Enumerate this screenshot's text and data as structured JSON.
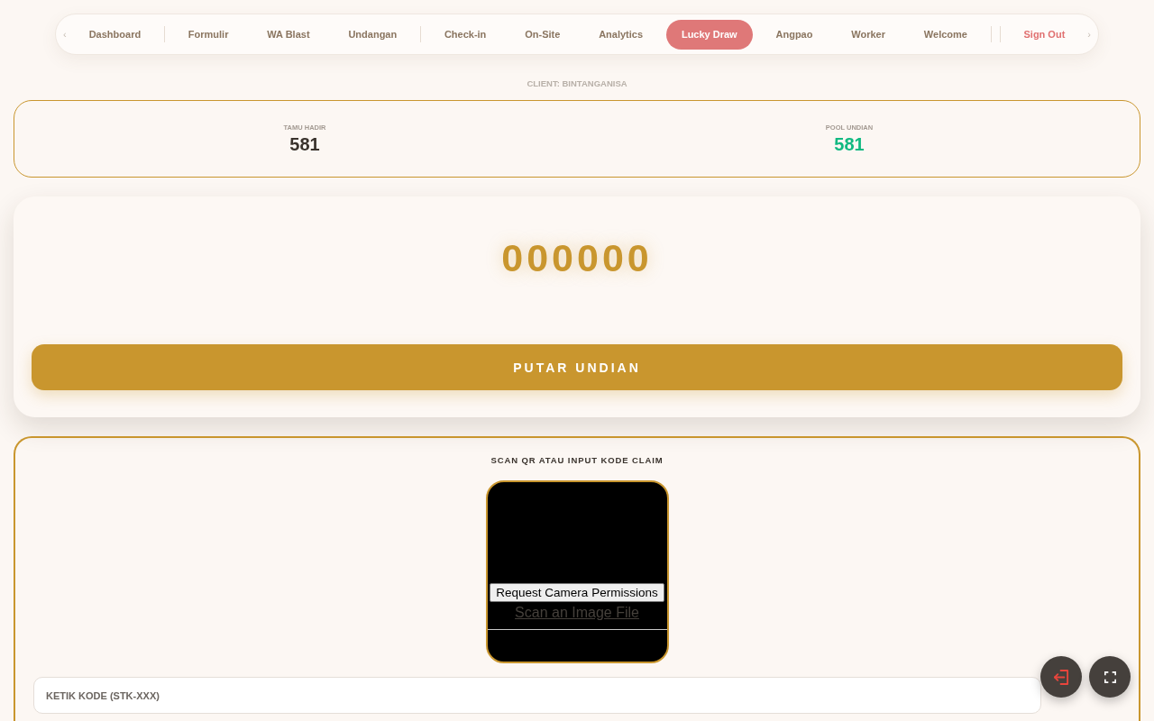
{
  "nav": {
    "scroll_left": "‹",
    "scroll_right": "›",
    "items": [
      {
        "kind": "link",
        "label": "Dashboard",
        "selected": false
      },
      {
        "kind": "divider"
      },
      {
        "kind": "link",
        "label": "Formulir",
        "selected": false
      },
      {
        "kind": "link",
        "label": "WA Blast",
        "selected": false
      },
      {
        "kind": "link",
        "label": "Undangan",
        "selected": false
      },
      {
        "kind": "divider"
      },
      {
        "kind": "link",
        "label": "Check-in",
        "selected": false
      },
      {
        "kind": "link",
        "label": "On-Site",
        "selected": false
      },
      {
        "kind": "link",
        "label": "Analytics",
        "selected": false
      },
      {
        "kind": "link",
        "label": "Lucky Draw",
        "selected": true
      },
      {
        "kind": "link",
        "label": "Angpao",
        "selected": false
      },
      {
        "kind": "link",
        "label": "Worker",
        "selected": false
      },
      {
        "kind": "link",
        "label": "Welcome",
        "selected": false
      },
      {
        "kind": "divider"
      },
      {
        "kind": "divider"
      },
      {
        "kind": "danger",
        "label": "Sign Out",
        "selected": false
      }
    ]
  },
  "client_label": "CLIENT: BINTANGANISA",
  "stats": [
    {
      "label": "TAMU HADIR",
      "value": "581",
      "color": "#3a332d"
    },
    {
      "label": "POOL UNDIAN",
      "value": "581",
      "color": "#10b981"
    }
  ],
  "draw": {
    "number": "000000",
    "button": "PUTAR UNDIAN"
  },
  "claim": {
    "title": "SCAN QR ATAU INPUT KODE CLAIM",
    "scanner": {
      "permission_button": "Request Camera Permissions",
      "file_link": "Scan an Image File"
    },
    "code_input": {
      "placeholder": "KETIK KODE (STK-XXX)"
    }
  },
  "floating_buttons": [
    {
      "kind": "exit"
    },
    {
      "kind": "fullscreen"
    }
  ]
}
